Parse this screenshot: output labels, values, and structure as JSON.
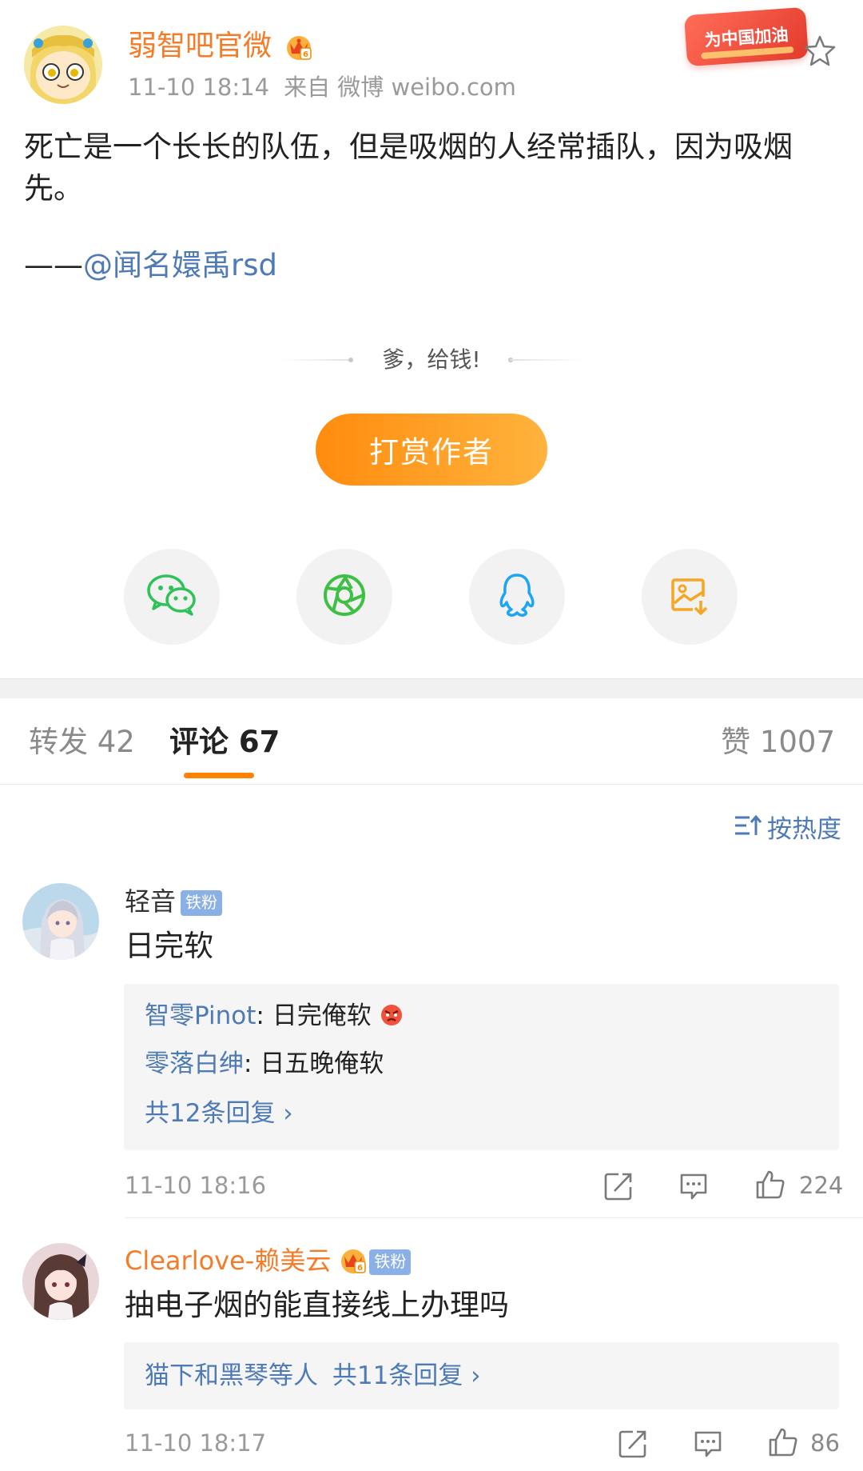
{
  "post": {
    "author": "弱智吧官微",
    "time": "11-10 18:14",
    "source": "来自 微博 weibo.com",
    "badge": "为中国加油",
    "text": "死亡是一个长长的队伍，但是吸烟的人经常插队，因为吸烟先。",
    "quote_prefix": "——",
    "quote_mention": "@闻名嬛禹rsd"
  },
  "reward": {
    "slogan": "爹，给钱!",
    "button": "打赏作者"
  },
  "share": [
    {
      "name": "wechat-icon",
      "color": "#2fc25a"
    },
    {
      "name": "moments-icon",
      "color": "#3fbf45"
    },
    {
      "name": "qq-icon",
      "color": "#1da5f2"
    },
    {
      "name": "save-image-icon",
      "color": "#f5a623"
    }
  ],
  "tabs": {
    "repost": "转发 42",
    "comments": "评论 67",
    "likes": "赞 1007"
  },
  "sort": {
    "label": "按热度",
    "icon": "sort-icon"
  },
  "comments": [
    {
      "user": "轻音",
      "badge": "铁粉",
      "text": "日完软",
      "replies": [
        {
          "user": "智零Pinot",
          "sep": ": ",
          "text": "日完俺软"
        },
        {
          "user": "零落白绅",
          "sep": ": ",
          "text": "日五晚俺软"
        }
      ],
      "more": "共12条回复 ›",
      "time": "11-10 18:16",
      "likes": "224"
    },
    {
      "user": "Clearlove-赖美云",
      "badge": "铁粉",
      "text": "抽电子烟的能直接线上办理吗",
      "summary_users": "猫下和黑琴等人",
      "more": "共11条回复 ›",
      "time": "11-10 18:17",
      "likes": "86"
    }
  ],
  "colors": {
    "accent": "#ff8200",
    "link": "#4e7ab5",
    "author": "#f47b27"
  }
}
